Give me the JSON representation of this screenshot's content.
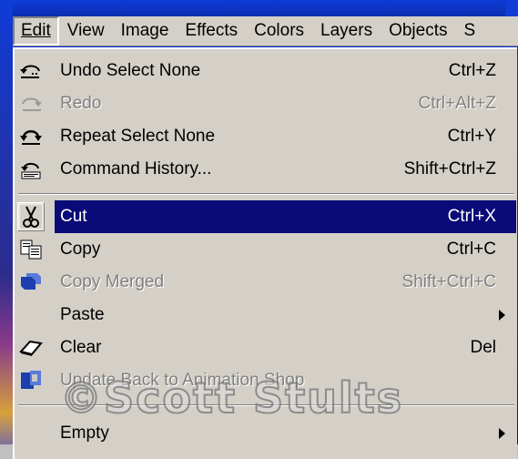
{
  "menubar": {
    "items": [
      {
        "label": "Edit",
        "active": true
      },
      {
        "label": "View"
      },
      {
        "label": "Image"
      },
      {
        "label": "Effects"
      },
      {
        "label": "Colors"
      },
      {
        "label": "Layers"
      },
      {
        "label": "Objects"
      },
      {
        "label": "S"
      }
    ]
  },
  "edit_menu": {
    "items": [
      {
        "label": "Undo Select None",
        "shortcut": "Ctrl+Z",
        "icon": "undo-icon"
      },
      {
        "label": "Redo",
        "shortcut": "Ctrl+Alt+Z",
        "icon": "redo-icon",
        "disabled": true
      },
      {
        "label": "Repeat Select None",
        "shortcut": "Ctrl+Y",
        "icon": "repeat-icon"
      },
      {
        "label": "Command History...",
        "shortcut": "Shift+Ctrl+Z",
        "icon": "history-icon"
      },
      {
        "label": "Cut",
        "shortcut": "Ctrl+X",
        "icon": "scissors-icon",
        "selected": true
      },
      {
        "label": "Copy",
        "shortcut": "Ctrl+C",
        "icon": "copy-icon"
      },
      {
        "label": "Copy Merged",
        "shortcut": "Shift+Ctrl+C",
        "icon": "copy-merged-icon",
        "disabled": true
      },
      {
        "label": "Paste",
        "submenu": true
      },
      {
        "label": "Clear",
        "shortcut": "Del",
        "icon": "eraser-icon"
      },
      {
        "label": "Update Back to Animation Shop",
        "icon": "animation-shop-icon",
        "disabled": true
      },
      {
        "label": "Empty",
        "submenu": true
      }
    ]
  },
  "watermark": "©Scott Stults",
  "colors": {
    "highlight": "#0a0a78",
    "menu_bg": "#d4d0c8",
    "disabled_text": "#808080"
  }
}
